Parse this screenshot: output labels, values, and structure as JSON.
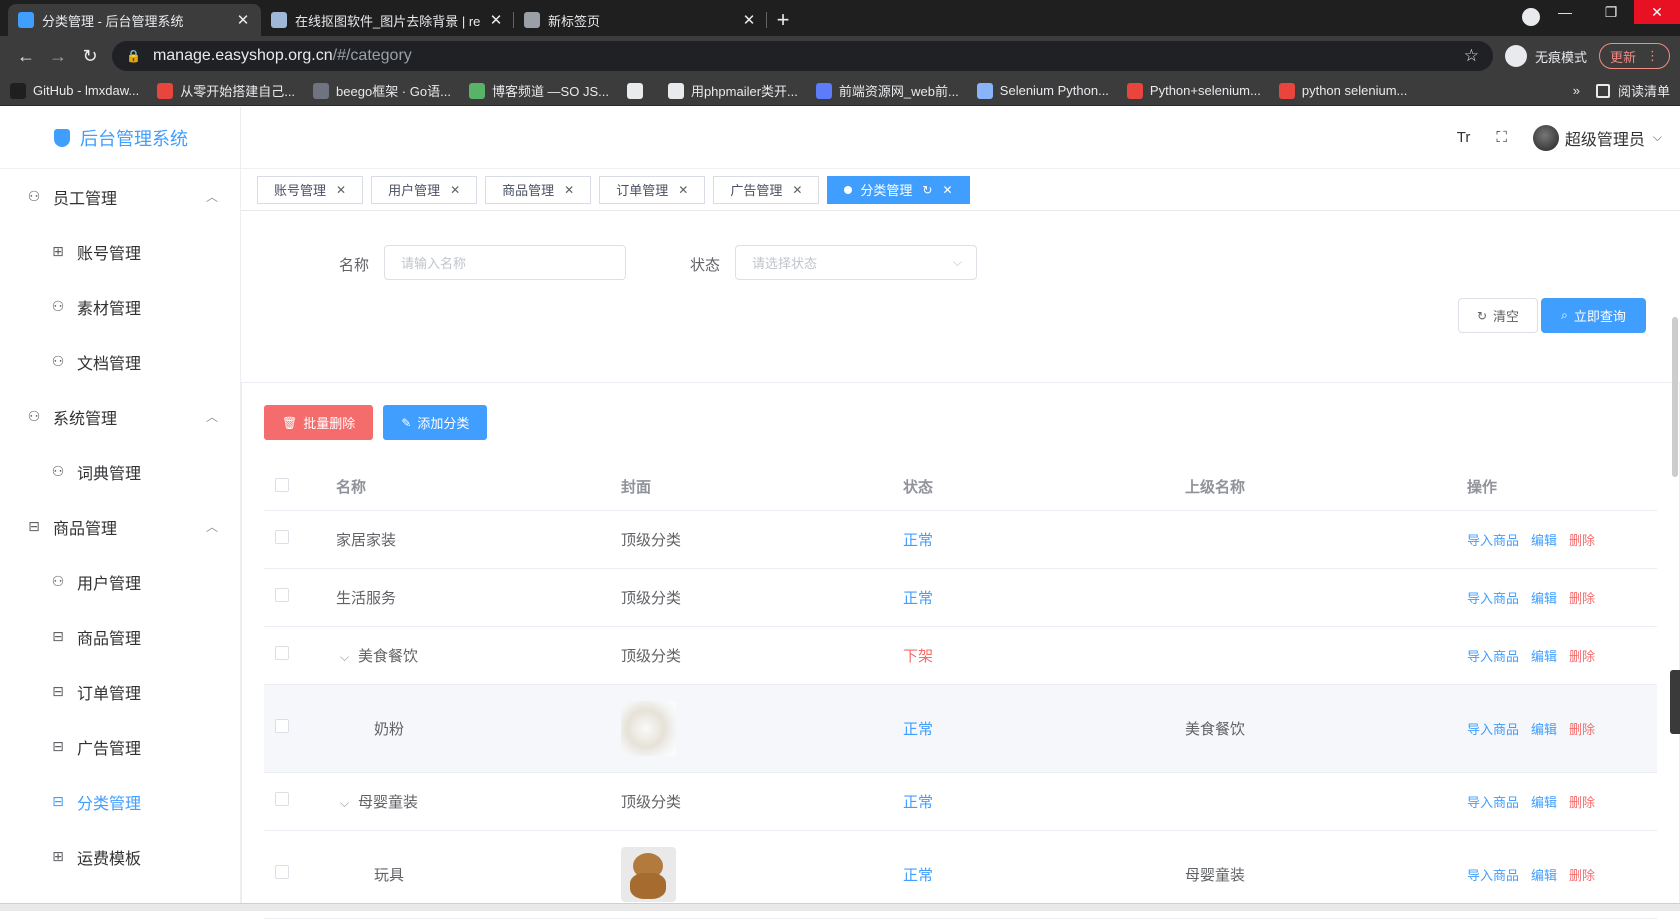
{
  "browser": {
    "tabs": [
      {
        "title": "分类管理 - 后台管理系统",
        "active": true,
        "favicon_color": "#409eff"
      },
      {
        "title": "在线抠图软件_图片去除背景 | re",
        "active": false,
        "favicon_color": "#9fb8d8"
      },
      {
        "title": "新标签页",
        "active": false,
        "favicon_color": "#9aa0a6"
      }
    ],
    "new_tab_glyph": "+",
    "url_host": "manage.easyshop.org.cn",
    "url_path": "/#/category",
    "incognito_label": "无痕模式",
    "update_label": "更新",
    "bookmarks": [
      {
        "label": "GitHub - lmxdaw...",
        "color": "#1f1f1f"
      },
      {
        "label": "从零开始搭建自己...",
        "color": "#e8453c"
      },
      {
        "label": "beego框架 · Go语...",
        "color": "#6f7580"
      },
      {
        "label": "博客频道 —SO JS...",
        "color": "#58b368"
      },
      {
        "label": "",
        "color": "#e8eaed"
      },
      {
        "label": "用phpmailer类开...",
        "color": "#e8eaed"
      },
      {
        "label": "前端资源网_web前...",
        "color": "#5c7cfa"
      },
      {
        "label": "Selenium Python...",
        "color": "#8ab4f8"
      },
      {
        "label": "Python+selenium...",
        "color": "#e8453c"
      },
      {
        "label": "python selenium...",
        "color": "#e8453c"
      }
    ],
    "bookmarks_more": "»",
    "reading_list_label": "阅读清单"
  },
  "app": {
    "logo_text": "后台管理系统",
    "accent": "#409eff",
    "danger": "#f56c6c",
    "sidebar": [
      {
        "type": "group",
        "label": "员工管理",
        "icon": "user-icon"
      },
      {
        "type": "item",
        "label": "账号管理",
        "icon": "grid-icon"
      },
      {
        "type": "item",
        "label": "素材管理",
        "icon": "user-icon"
      },
      {
        "type": "item",
        "label": "文档管理",
        "icon": "user-icon"
      },
      {
        "type": "group",
        "label": "系统管理",
        "icon": "user-icon"
      },
      {
        "type": "item",
        "label": "词典管理",
        "icon": "user-icon"
      },
      {
        "type": "group",
        "label": "商品管理",
        "icon": "briefcase-icon"
      },
      {
        "type": "item",
        "label": "用户管理",
        "icon": "user-icon"
      },
      {
        "type": "item",
        "label": "商品管理",
        "icon": "briefcase-icon"
      },
      {
        "type": "item",
        "label": "订单管理",
        "icon": "briefcase-icon"
      },
      {
        "type": "item",
        "label": "广告管理",
        "icon": "briefcase-icon"
      },
      {
        "type": "item",
        "label": "分类管理",
        "icon": "briefcase-icon",
        "active": true
      },
      {
        "type": "item",
        "label": "运费模板",
        "icon": "grid-icon"
      }
    ],
    "header": {
      "font_size_glyph": "Tr",
      "fullscreen_glyph": "⛶",
      "username": "超级管理员"
    },
    "tags": [
      {
        "label": "账号管理"
      },
      {
        "label": "用户管理"
      },
      {
        "label": "商品管理"
      },
      {
        "label": "订单管理"
      },
      {
        "label": "广告管理"
      },
      {
        "label": "分类管理",
        "active": true
      }
    ],
    "filters": {
      "name_label": "名称",
      "name_placeholder": "请输入名称",
      "status_label": "状态",
      "status_placeholder": "请选择状态",
      "clear_label": "清空",
      "query_label": "立即查询"
    },
    "actions": {
      "batch_delete_label": "批量删除",
      "add_label": "添加分类"
    },
    "table": {
      "columns": [
        "名称",
        "封面",
        "状态",
        "上级名称",
        "操作"
      ],
      "rows": [
        {
          "name": "家居家装",
          "cover": "顶级分类",
          "status": "正常",
          "parent": "",
          "level": 0,
          "expandable": false
        },
        {
          "name": "生活服务",
          "cover": "顶级分类",
          "status": "正常",
          "parent": "",
          "level": 0,
          "expandable": false
        },
        {
          "name": "美食餐饮",
          "cover": "顶级分类",
          "status": "下架",
          "parent": "",
          "level": 0,
          "expandable": true
        },
        {
          "name": "奶粉",
          "cover": "",
          "cover_image": "milk",
          "status": "正常",
          "parent": "美食餐饮",
          "level": 1,
          "expandable": false,
          "hover": true
        },
        {
          "name": "母婴童装",
          "cover": "顶级分类",
          "status": "正常",
          "parent": "",
          "level": 0,
          "expandable": true
        },
        {
          "name": "玩具",
          "cover": "",
          "cover_image": "bear",
          "status": "正常",
          "parent": "母婴童装",
          "level": 1,
          "expandable": false
        }
      ],
      "ops": {
        "import": "导入商品",
        "edit": "编辑",
        "delete": "删除"
      }
    }
  }
}
